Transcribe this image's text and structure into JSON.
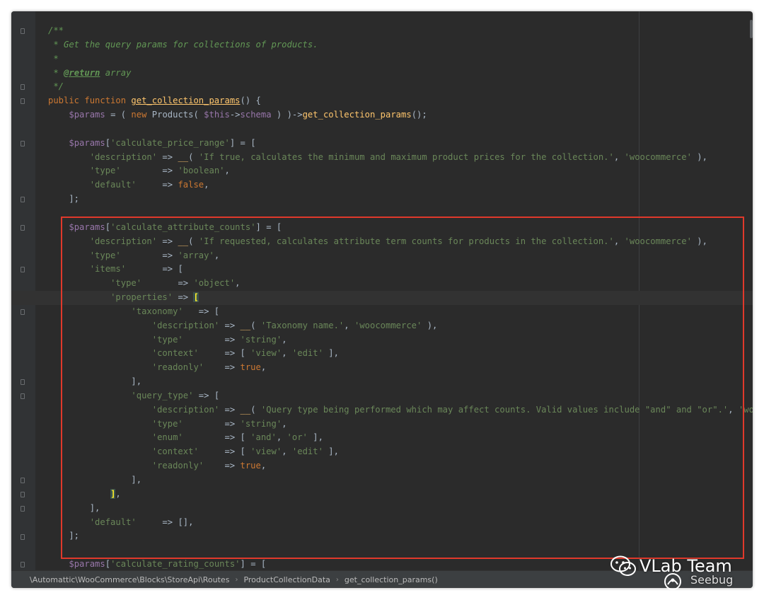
{
  "code_lines": [
    {
      "tokens": [
        {
          "t": "/**",
          "c": "c"
        }
      ]
    },
    {
      "tokens": [
        {
          "t": " * Get the query params for collections of products.",
          "c": "c"
        }
      ]
    },
    {
      "tokens": [
        {
          "t": " *",
          "c": "c"
        }
      ]
    },
    {
      "tokens": [
        {
          "t": " * ",
          "c": "c"
        },
        {
          "t": "@return",
          "c": "tag"
        },
        {
          "t": " array",
          "c": "c"
        }
      ]
    },
    {
      "tokens": [
        {
          "t": " */",
          "c": "c"
        }
      ]
    },
    {
      "tokens": [
        {
          "t": "public function ",
          "c": "k"
        },
        {
          "t": "get_collection_params",
          "c": "fnu"
        },
        {
          "t": "() {",
          "c": "p"
        }
      ]
    },
    {
      "tokens": [
        {
          "t": "    "
        },
        {
          "t": "$params",
          "c": "v"
        },
        {
          "t": " = ( "
        },
        {
          "t": "new ",
          "c": "k"
        },
        {
          "t": "Products( "
        },
        {
          "t": "$this",
          "c": "v"
        },
        {
          "t": "->"
        },
        {
          "t": "schema",
          "c": "v"
        },
        {
          "t": " ) )->"
        },
        {
          "t": "get_collection_params",
          "c": "fn"
        },
        {
          "t": "();"
        }
      ]
    },
    {
      "tokens": [
        {
          "t": ""
        }
      ]
    },
    {
      "tokens": [
        {
          "t": "    "
        },
        {
          "t": "$params",
          "c": "v"
        },
        {
          "t": "["
        },
        {
          "t": "'calculate_price_range'",
          "c": "s"
        },
        {
          "t": "] = ["
        }
      ]
    },
    {
      "tokens": [
        {
          "t": "        "
        },
        {
          "t": "'description'",
          "c": "s"
        },
        {
          "t": " => "
        },
        {
          "t": "__",
          "c": "fn"
        },
        {
          "t": "( "
        },
        {
          "t": "'If true, calculates the minimum and maximum product prices for the collection.'",
          "c": "s"
        },
        {
          "t": ", "
        },
        {
          "t": "'woocommerce'",
          "c": "s"
        },
        {
          "t": " ),"
        }
      ]
    },
    {
      "tokens": [
        {
          "t": "        "
        },
        {
          "t": "'type'",
          "c": "s"
        },
        {
          "t": "        => "
        },
        {
          "t": "'boolean'",
          "c": "s"
        },
        {
          "t": ","
        }
      ]
    },
    {
      "tokens": [
        {
          "t": "        "
        },
        {
          "t": "'default'",
          "c": "s"
        },
        {
          "t": "     => "
        },
        {
          "t": "false",
          "c": "k"
        },
        {
          "t": ","
        }
      ]
    },
    {
      "tokens": [
        {
          "t": "    ];"
        }
      ]
    },
    {
      "tokens": [
        {
          "t": ""
        }
      ]
    },
    {
      "tokens": [
        {
          "t": "    "
        },
        {
          "t": "$params",
          "c": "v"
        },
        {
          "t": "["
        },
        {
          "t": "'calculate_attribute_counts'",
          "c": "s"
        },
        {
          "t": "] = ["
        }
      ]
    },
    {
      "tokens": [
        {
          "t": "        "
        },
        {
          "t": "'description'",
          "c": "s"
        },
        {
          "t": " => "
        },
        {
          "t": "__",
          "c": "fn"
        },
        {
          "t": "( "
        },
        {
          "t": "'If requested, calculates attribute term counts for products in the collection.'",
          "c": "s"
        },
        {
          "t": ", "
        },
        {
          "t": "'woocommerce'",
          "c": "s"
        },
        {
          "t": " ),"
        }
      ]
    },
    {
      "tokens": [
        {
          "t": "        "
        },
        {
          "t": "'type'",
          "c": "s"
        },
        {
          "t": "        => "
        },
        {
          "t": "'array'",
          "c": "s"
        },
        {
          "t": ","
        }
      ]
    },
    {
      "tokens": [
        {
          "t": "        "
        },
        {
          "t": "'items'",
          "c": "s"
        },
        {
          "t": "       => ["
        }
      ]
    },
    {
      "tokens": [
        {
          "t": "            "
        },
        {
          "t": "'type'",
          "c": "s"
        },
        {
          "t": "       => "
        },
        {
          "t": "'object'",
          "c": "s"
        },
        {
          "t": ","
        }
      ]
    },
    {
      "tokens": [
        {
          "t": "            "
        },
        {
          "t": "'properties'",
          "c": "s"
        },
        {
          "t": " => "
        },
        {
          "t": "[",
          "c": "bm"
        }
      ],
      "current": true
    },
    {
      "tokens": [
        {
          "t": "                "
        },
        {
          "t": "'taxonomy'",
          "c": "s"
        },
        {
          "t": "   => ["
        }
      ]
    },
    {
      "tokens": [
        {
          "t": "                    "
        },
        {
          "t": "'description'",
          "c": "s"
        },
        {
          "t": " => "
        },
        {
          "t": "__",
          "c": "fn"
        },
        {
          "t": "( "
        },
        {
          "t": "'Taxonomy name.'",
          "c": "s"
        },
        {
          "t": ", "
        },
        {
          "t": "'woocommerce'",
          "c": "s"
        },
        {
          "t": " ),"
        }
      ]
    },
    {
      "tokens": [
        {
          "t": "                    "
        },
        {
          "t": "'type'",
          "c": "s"
        },
        {
          "t": "        => "
        },
        {
          "t": "'string'",
          "c": "s"
        },
        {
          "t": ","
        }
      ]
    },
    {
      "tokens": [
        {
          "t": "                    "
        },
        {
          "t": "'context'",
          "c": "s"
        },
        {
          "t": "     => [ "
        },
        {
          "t": "'view'",
          "c": "s"
        },
        {
          "t": ", "
        },
        {
          "t": "'edit'",
          "c": "s"
        },
        {
          "t": " ],"
        }
      ]
    },
    {
      "tokens": [
        {
          "t": "                    "
        },
        {
          "t": "'readonly'",
          "c": "s"
        },
        {
          "t": "    => "
        },
        {
          "t": "true",
          "c": "k"
        },
        {
          "t": ","
        }
      ]
    },
    {
      "tokens": [
        {
          "t": "                ],"
        }
      ]
    },
    {
      "tokens": [
        {
          "t": "                "
        },
        {
          "t": "'query_type'",
          "c": "s"
        },
        {
          "t": " => ["
        }
      ]
    },
    {
      "tokens": [
        {
          "t": "                    "
        },
        {
          "t": "'description'",
          "c": "s"
        },
        {
          "t": " => "
        },
        {
          "t": "__",
          "c": "fn"
        },
        {
          "t": "( "
        },
        {
          "t": "'Query type being performed which may affect counts. Valid values include \"and\" and \"or\".'",
          "c": "s"
        },
        {
          "t": ", "
        },
        {
          "t": "'wooc",
          "c": "s"
        }
      ]
    },
    {
      "tokens": [
        {
          "t": "                    "
        },
        {
          "t": "'type'",
          "c": "s"
        },
        {
          "t": "        => "
        },
        {
          "t": "'string'",
          "c": "s"
        },
        {
          "t": ","
        }
      ]
    },
    {
      "tokens": [
        {
          "t": "                    "
        },
        {
          "t": "'enum'",
          "c": "s"
        },
        {
          "t": "        => [ "
        },
        {
          "t": "'and'",
          "c": "s"
        },
        {
          "t": ", "
        },
        {
          "t": "'or'",
          "c": "s"
        },
        {
          "t": " ],"
        }
      ]
    },
    {
      "tokens": [
        {
          "t": "                    "
        },
        {
          "t": "'context'",
          "c": "s"
        },
        {
          "t": "     => [ "
        },
        {
          "t": "'view'",
          "c": "s"
        },
        {
          "t": ", "
        },
        {
          "t": "'edit'",
          "c": "s"
        },
        {
          "t": " ],"
        }
      ]
    },
    {
      "tokens": [
        {
          "t": "                    "
        },
        {
          "t": "'readonly'",
          "c": "s"
        },
        {
          "t": "    => "
        },
        {
          "t": "true",
          "c": "k"
        },
        {
          "t": ","
        }
      ]
    },
    {
      "tokens": [
        {
          "t": "                ],"
        }
      ]
    },
    {
      "tokens": [
        {
          "t": "            "
        },
        {
          "t": "]",
          "c": "bm"
        },
        {
          "t": ","
        }
      ]
    },
    {
      "tokens": [
        {
          "t": "        ],"
        }
      ]
    },
    {
      "tokens": [
        {
          "t": "        "
        },
        {
          "t": "'default'",
          "c": "s"
        },
        {
          "t": "     => [],"
        }
      ]
    },
    {
      "tokens": [
        {
          "t": "    ];"
        }
      ]
    },
    {
      "tokens": [
        {
          "t": ""
        }
      ]
    },
    {
      "tokens": [
        {
          "t": "    "
        },
        {
          "t": "$params",
          "c": "v"
        },
        {
          "t": "["
        },
        {
          "t": "'calculate_rating_counts'",
          "c": "s"
        },
        {
          "t": "] = ["
        }
      ]
    }
  ],
  "breadcrumb": {
    "items": [
      "\\Automattic\\WooCommerce\\Blocks\\StoreApi\\Routes",
      "ProductCollectionData",
      "get_collection_params()"
    ],
    "separator": "›"
  },
  "watermark": {
    "title": "VLab Team",
    "subtitle": "Seebug"
  },
  "colors": {
    "editor_bg": "#2b2b2b",
    "highlight_box": "#e0392b",
    "comment": "#629755",
    "keyword": "#cc7832",
    "string": "#6a8759",
    "variable": "#9876aa",
    "function": "#ffc66d"
  }
}
